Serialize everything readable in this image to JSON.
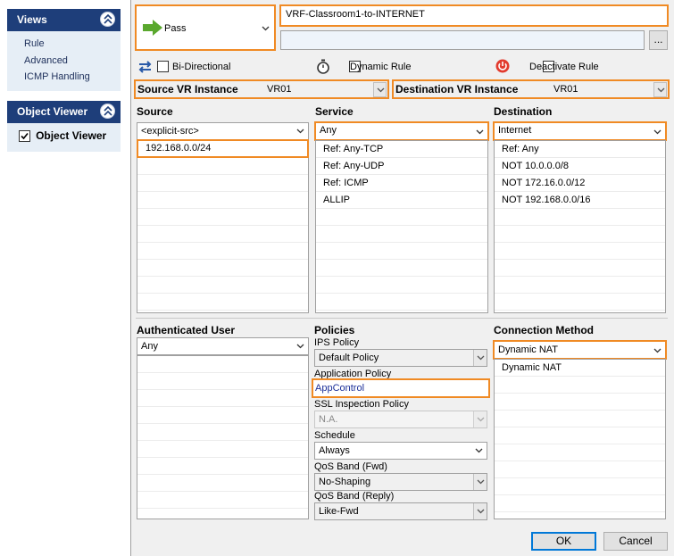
{
  "sidebar": {
    "views_title": "Views",
    "views_items": [
      "Rule",
      "Advanced",
      "ICMP Handling"
    ],
    "object_viewer_title": "Object Viewer",
    "object_viewer_checkbox": "Object Viewer"
  },
  "rule": {
    "action": "Pass",
    "name": "VRF-Classroom1-to-INTERNET",
    "comment": "",
    "more_button": "...",
    "bidirectional_label": "Bi-Directional",
    "dynamic_rule_label": "Dynamic Rule",
    "deactivate_rule_label": "Deactivate Rule"
  },
  "vr": {
    "source_label": "Source VR Instance",
    "source_value": "VR01",
    "dest_label": "Destination VR Instance",
    "dest_value": "VR01"
  },
  "source": {
    "header": "Source",
    "combo": "<explicit-src>",
    "items": [
      "192.168.0.0/24"
    ]
  },
  "service": {
    "header": "Service",
    "combo": "Any",
    "items": [
      "Ref: Any-TCP",
      "Ref: Any-UDP",
      "Ref: ICMP",
      "ALLIP"
    ]
  },
  "destination": {
    "header": "Destination",
    "combo": "Internet",
    "items": [
      "Ref: Any",
      "NOT 10.0.0.0/8",
      "NOT 172.16.0.0/12",
      "NOT 192.168.0.0/16"
    ]
  },
  "auth_user": {
    "header": "Authenticated User",
    "combo": "Any"
  },
  "policies": {
    "header": "Policies",
    "ips_label": "IPS Policy",
    "ips_value": "Default Policy",
    "app_label": "Application Policy",
    "app_value": "AppControl",
    "ssl_label": "SSL Inspection Policy",
    "ssl_value": "N.A.",
    "schedule_label": "Schedule",
    "schedule_value": "Always",
    "qos_fwd_label": "QoS Band (Fwd)",
    "qos_fwd_value": "No-Shaping",
    "qos_reply_label": "QoS Band (Reply)",
    "qos_reply_value": "Like-Fwd"
  },
  "connection": {
    "header": "Connection Method",
    "combo": "Dynamic NAT",
    "items": [
      "Dynamic NAT"
    ]
  },
  "buttons": {
    "ok": "OK",
    "cancel": "Cancel"
  },
  "colors": {
    "highlight": "#f08a24",
    "sidebar_header": "#1e3e7a",
    "pass_arrow": "#5aa82e",
    "deactivate_icon": "#e23b2e"
  }
}
